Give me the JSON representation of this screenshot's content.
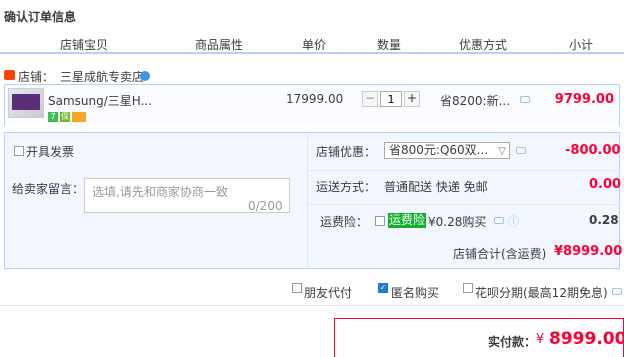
{
  "page_title": "确认订单信息",
  "columns": [
    "店铺宝贝",
    "商品属性",
    "单价",
    "数量",
    "优惠方式",
    "小计"
  ],
  "shop": {
    "label": "店铺：",
    "name": "三星成航专卖店"
  },
  "item": {
    "title": "Samsung/三星H...",
    "badges": [
      "7",
      "保",
      ""
    ],
    "unit_price": "17999.00",
    "quantity": "1",
    "qty_minus": "−",
    "qty_plus": "+",
    "discount": "省8200:新...",
    "subtotal": "9799.00"
  },
  "invoice": {
    "label": "开具发票"
  },
  "memo": {
    "label": "给卖家留言：",
    "placeholder": "选填,请先和商家协商一致",
    "count": "0/200"
  },
  "shop_discount": {
    "label": "店铺优惠：",
    "selected": "省800元:Q60双...",
    "amount": "-800.00"
  },
  "shipping": {
    "label": "运送方式：",
    "value": "普通配送 快递 免邮",
    "amount": "0.00"
  },
  "insurance": {
    "label": "运费险：",
    "tag": "运费险",
    "desc": "¥0.28购买",
    "amount": "0.28"
  },
  "shop_total": {
    "label": "店铺合计(含运费)",
    "value": "¥8999.00"
  },
  "options": [
    {
      "label": "朋友代付",
      "checked": false
    },
    {
      "label": "匿名购买",
      "checked": true
    },
    {
      "label": "花呗分期(最高12期免息)",
      "checked": false
    }
  ],
  "payment": {
    "label": "实付款：",
    "currency": "¥",
    "amount": "8999.00"
  },
  "colors": {
    "accent_red": "#ff0036",
    "border_blue": "#b2d1ff",
    "panel_bg": "#f2f7ff",
    "tag_green": "#12b12b"
  }
}
